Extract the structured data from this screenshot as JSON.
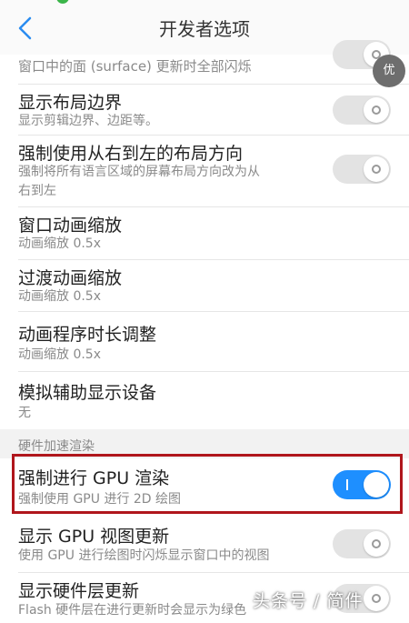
{
  "header": {
    "title": "开发者选项",
    "back_icon": "chevron-left-icon",
    "accent": "#2a8cf0"
  },
  "rows": {
    "surface_flash": {
      "subtitle": "窗口中的面 (surface) 更新时全部闪烁"
    },
    "layout_bounds": {
      "title": "显示布局边界",
      "subtitle": "显示剪辑边界、边距等。",
      "enabled": false
    },
    "rtl": {
      "title": "强制使用从右到左的布局方向",
      "subtitle_line1": "强制将所有语言区域的屏幕布局方向改为从",
      "subtitle_line2": "右到左",
      "enabled": false
    },
    "window_anim": {
      "title": "窗口动画缩放",
      "value": "动画缩放 0.5x"
    },
    "transition_anim": {
      "title": "过渡动画缩放",
      "value": "动画缩放 0.5x"
    },
    "animator_duration": {
      "title": "动画程序时长调整",
      "value": "动画缩放 0.5x"
    },
    "secondary_display": {
      "title": "模拟辅助显示设备",
      "value": "无"
    },
    "section_hw": {
      "label": "硬件加速渲染"
    },
    "force_gpu": {
      "title": "强制进行 GPU 渲染",
      "subtitle": "强制使用 GPU 进行 2D 绘图",
      "enabled": true
    },
    "gpu_view_updates": {
      "title": "显示 GPU 视图更新",
      "subtitle": "使用 GPU 进行绘图时闪烁显示窗口中的视图",
      "enabled": false
    },
    "hw_layer_updates": {
      "title": "显示硬件层更新",
      "subtitle": "Flash 硬件层在进行更新时会显示为绿色",
      "enabled": false
    }
  },
  "fab": {
    "label": "优"
  },
  "watermark": {
    "text": "头条号 / 简件"
  },
  "colors": {
    "toggle_on": "#1e8fff",
    "toggle_off": "#e3e3e3",
    "highlight": "#b0161c"
  }
}
